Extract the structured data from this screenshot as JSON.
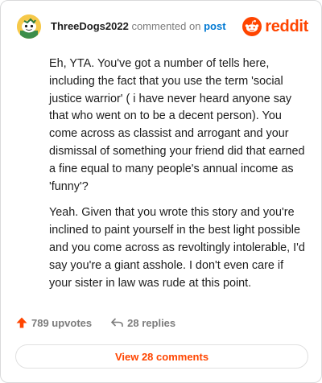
{
  "header": {
    "username": "ThreeDogs2022",
    "action_text": "commented on",
    "post_link": "post",
    "brand_name": "reddit"
  },
  "comment": {
    "paragraphs": [
      "Eh, YTA. You've got a number of tells here, including the fact that you use the term 'social justice warrior' ( i have never heard anyone say that who went on to be a decent person). You come across as classist and arrogant and your dismissal of something your friend did that earned a fine equal to many people's annual income as 'funny'?",
      "Yeah. Given that you wrote this story and you're inclined to paint yourself in the best light possible and you come across as revoltingly intolerable, I'd say you're a giant asshole. I don't even care if your sister in law was rude at this point."
    ]
  },
  "actions": {
    "upvotes": "789 upvotes",
    "replies": "28 replies"
  },
  "footer": {
    "view_comments": "View 28 comments"
  },
  "colors": {
    "brand": "#ff4500",
    "link": "#0079d3",
    "muted": "#7c7c7c"
  },
  "icons": {
    "avatar": "snoo-avatar",
    "logo": "reddit-logo-icon",
    "upvote": "upvote-arrow-icon",
    "reply": "reply-arrow-icon"
  }
}
